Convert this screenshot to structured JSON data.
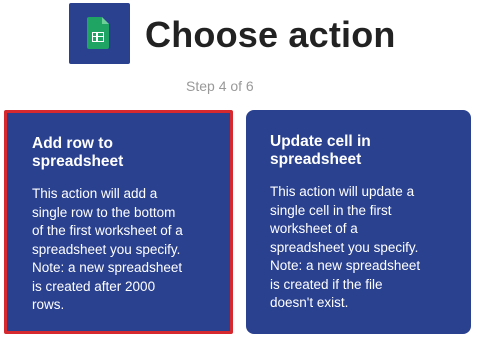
{
  "header": {
    "app_icon": "google-sheets-icon",
    "title": "Choose action",
    "step": "Step 4 of 6"
  },
  "colors": {
    "card_bg": "#2a4190",
    "selected_border": "#d6282f",
    "sheets_green": "#1fa463",
    "title_text": "#222222",
    "step_text": "#999999"
  },
  "actions": [
    {
      "title_line1": "Add row to",
      "title_line2": "spreadsheet",
      "desc_lines": [
        "This action will add a",
        "single row to the bottom",
        "of the first worksheet of a",
        "spreadsheet you specify.",
        "Note: a new spreadsheet",
        "is created after 2000",
        "rows."
      ],
      "selected": true
    },
    {
      "title_line1": "Update cell in",
      "title_line2": "spreadsheet",
      "desc_lines": [
        "This action will update a",
        "single cell in the first",
        "worksheet of a",
        "spreadsheet you specify.",
        "Note: a new spreadsheet",
        "is created if the file",
        "doesn't exist."
      ],
      "selected": false
    }
  ]
}
